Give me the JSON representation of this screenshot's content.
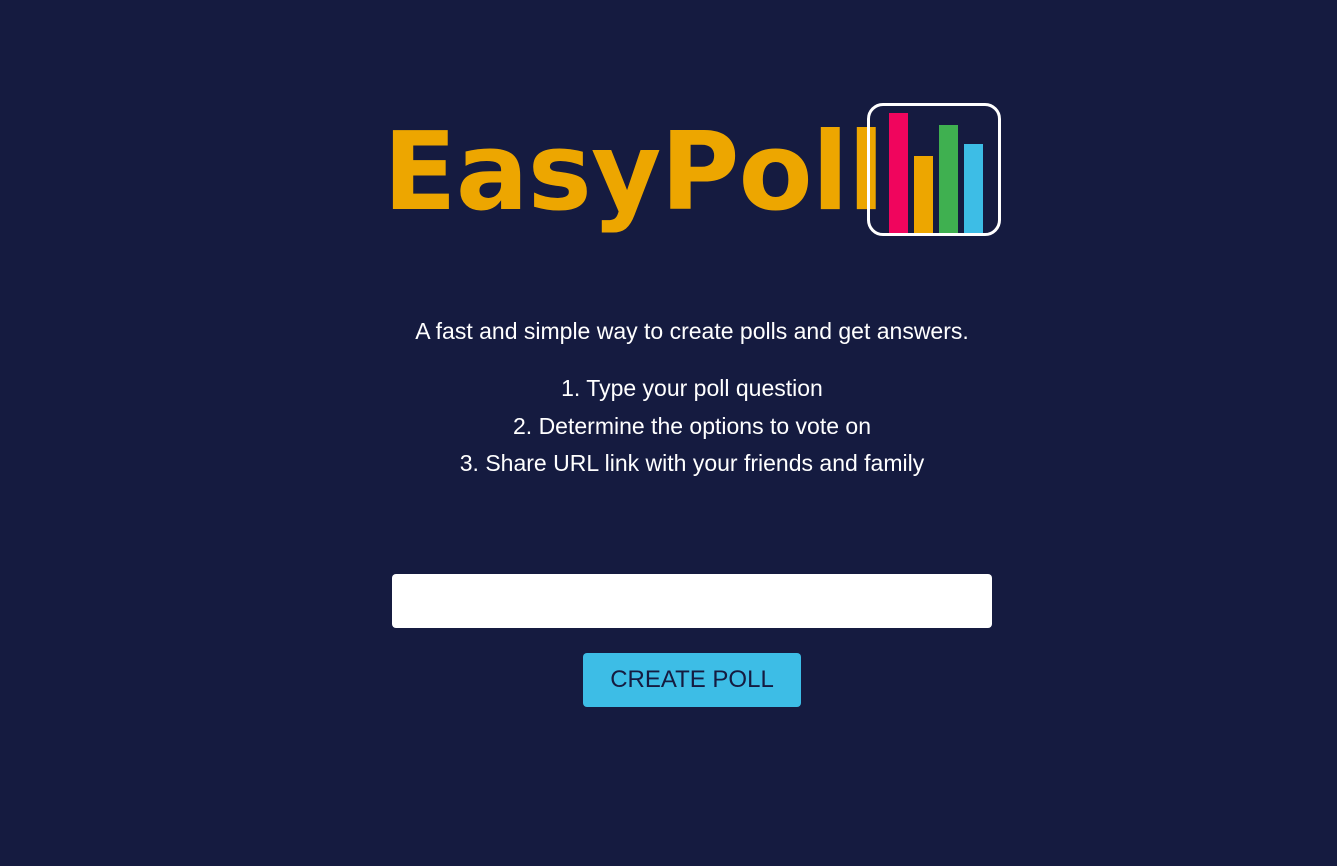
{
  "brand": {
    "name": "EasyPoll",
    "name_color": "#eda600",
    "icon": "bar-chart-icon",
    "icon_bar_colors": [
      "#f0055d",
      "#eda600",
      "#3fb050",
      "#3dbde6"
    ]
  },
  "intro": {
    "tagline": "A fast and simple way to create polls and get answers.",
    "steps": [
      "1. Type your poll question",
      "2. Determine the options to vote on",
      "3. Share URL link with your friends and family"
    ]
  },
  "form": {
    "question_value": "",
    "question_placeholder": "",
    "create_label": "CREATE POLL"
  },
  "colors": {
    "background": "#151b40",
    "accent": "#3dbde6",
    "text": "#ffffff"
  }
}
